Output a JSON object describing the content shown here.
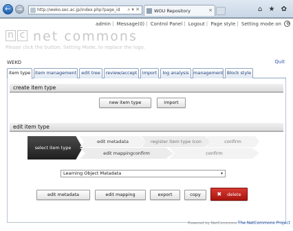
{
  "browser": {
    "address": "http://weko.sec.ac.jp/index.php?page_id=",
    "tab_title": "WOU Repository",
    "back": "←",
    "forward": "→",
    "refresh_icons": "⌕ ▾ ✕",
    "tab_close": "×",
    "window_icons": "⌂ ★ ✿"
  },
  "topmenu": {
    "user": "admin",
    "message": "Message(0)",
    "control_panel": "Control Panel",
    "logout": "Logout",
    "page_style": "Page style",
    "setting_mode": "Setting mode on",
    "sep": "|",
    "gear": "⚙"
  },
  "logo": {
    "box1": "n",
    "box2": "c",
    "name": "net commons",
    "note": "Please click the button, Setting Mode, to replace the logo."
  },
  "module": {
    "title": "WEKO",
    "quit": "Quit"
  },
  "tabs": [
    {
      "label": "item type",
      "active": true
    },
    {
      "label": "item management"
    },
    {
      "label": "edit tree"
    },
    {
      "label": "review/accept"
    },
    {
      "label": "import"
    },
    {
      "label": "log analysis"
    },
    {
      "label": "management"
    },
    {
      "label": "Block style"
    }
  ],
  "create_section": {
    "title": "create item type",
    "new_button": "new item type",
    "import_button": "import"
  },
  "edit_section": {
    "title": "edit item type",
    "flow": {
      "start": "select item type",
      "row1": [
        "edit metadata",
        "register item type icon",
        "confirm"
      ],
      "row2": [
        "edit mappingconfirm",
        "confirm"
      ]
    },
    "selected_item_type": "Learning Object Matadata",
    "dropdown_arrow": "▾",
    "buttons": {
      "edit_metadata": "edit metadata",
      "edit_mapping": "edit mapping",
      "export": "export",
      "copy": "copy",
      "delete": "delete",
      "delete_mark": "✖"
    }
  },
  "footer": {
    "powered": "Powered by NetCommons",
    "project": "The NetCommons Project"
  },
  "colors": {
    "accent_blue": "#2a54a8",
    "delete_red": "#c0221a",
    "flow_dark": "#2a2a2a"
  }
}
